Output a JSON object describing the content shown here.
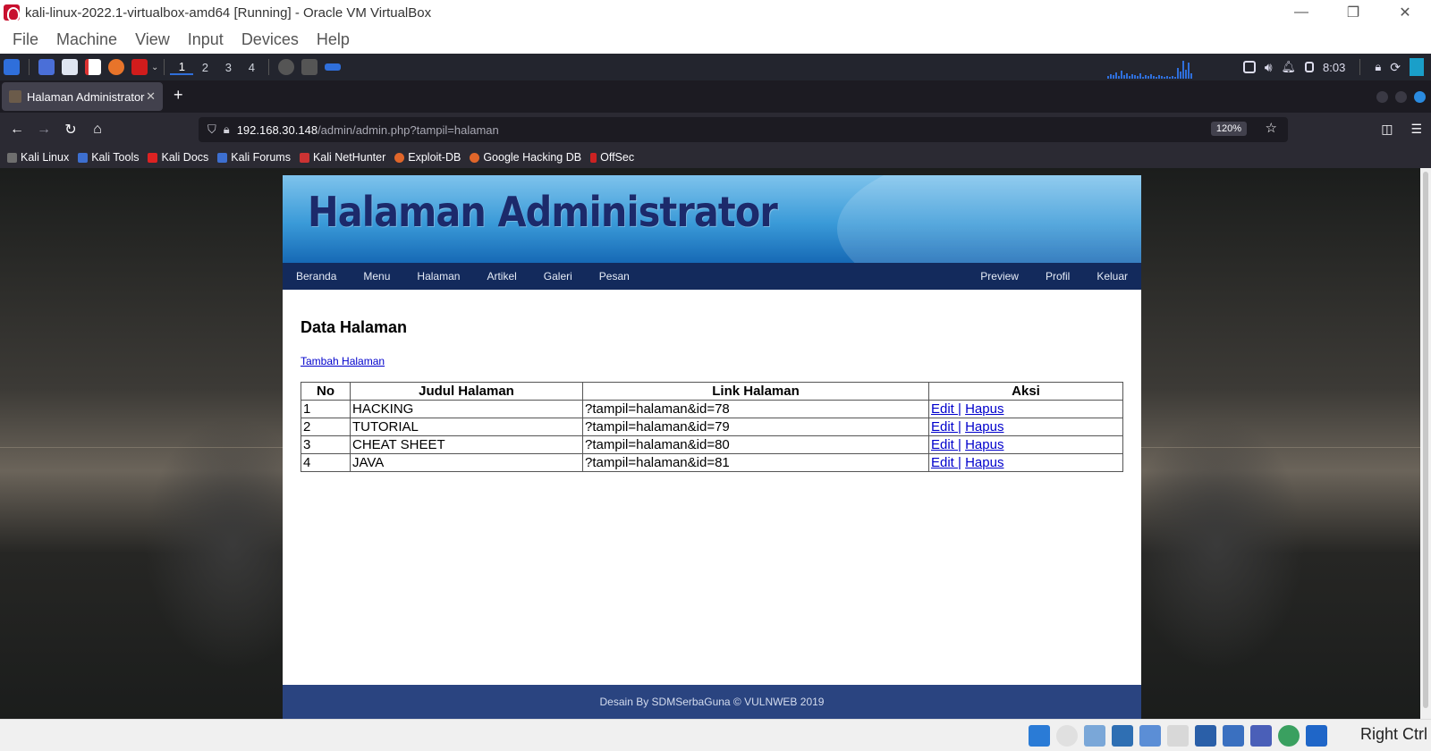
{
  "vbox": {
    "title": "kali-linux-2022.1-virtualbox-amd64 [Running] - Oracle VM VirtualBox",
    "menu": [
      "File",
      "Machine",
      "View",
      "Input",
      "Devices",
      "Help"
    ],
    "host_key": "Right Ctrl"
  },
  "panel": {
    "workspaces": [
      "1",
      "2",
      "3",
      "4"
    ],
    "clock": "8:03"
  },
  "browser": {
    "tab_title": "Halaman Administrator",
    "url_host": "192.168.30.148",
    "url_path": "/admin/admin.php?tampil=halaman",
    "zoom": "120%",
    "bookmarks": [
      "Kali Linux",
      "Kali Tools",
      "Kali Docs",
      "Kali Forums",
      "Kali NetHunter",
      "Exploit-DB",
      "Google Hacking DB",
      "OffSec"
    ]
  },
  "site": {
    "banner_title": "Halaman Administrator",
    "nav_left": [
      "Beranda",
      "Menu",
      "Halaman",
      "Artikel",
      "Galeri",
      "Pesan"
    ],
    "nav_right": [
      "Preview",
      "Profil",
      "Keluar"
    ],
    "heading": "Data Halaman",
    "add_link": "Tambah Halaman",
    "table": {
      "headers": [
        "No",
        "Judul Halaman",
        "Link Halaman",
        "Aksi"
      ],
      "rows": [
        {
          "no": "1",
          "judul": "HACKING",
          "link": "?tampil=halaman&id=78",
          "edit": "Edit ",
          "sep": "|",
          "hapus": "Hapus"
        },
        {
          "no": "2",
          "judul": "TUTORIAL",
          "link": "?tampil=halaman&id=79",
          "edit": "Edit ",
          "sep": "|",
          "hapus": "Hapus"
        },
        {
          "no": "3",
          "judul": "CHEAT SHEET",
          "link": "?tampil=halaman&id=80",
          "edit": "Edit ",
          "sep": "|",
          "hapus": "Hapus"
        },
        {
          "no": "4",
          "judul": "JAVA",
          "link": "?tampil=halaman&id=81",
          "edit": "Edit ",
          "sep": "|",
          "hapus": "Hapus"
        }
      ]
    },
    "footer": "Desain By SDMSerbaGuna © VULNWEB 2019"
  }
}
